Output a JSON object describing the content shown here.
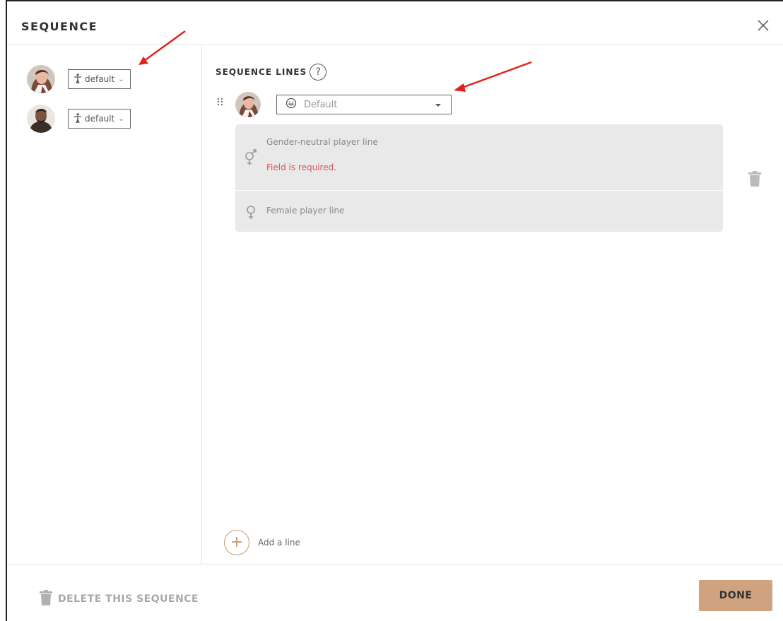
{
  "dialog": {
    "title": "SEQUENCE",
    "close_icon": "close-icon"
  },
  "characters": [
    {
      "avatar": "avatar-woman",
      "pose_icon": "person-pose-icon",
      "pose_label": "default"
    },
    {
      "avatar": "avatar-man",
      "pose_icon": "person-pose-icon",
      "pose_label": "default"
    }
  ],
  "sequence_lines": {
    "title": "SEQUENCE LINES",
    "help_icon": "?",
    "line": {
      "mood_placeholder": "Default",
      "gender_neutral_label": "Gender-neutral player line",
      "error": "Field is required.",
      "female_label": "Female player line"
    },
    "add_line_label": "Add a line",
    "add_icon": "+"
  },
  "footer": {
    "delete_label": "DELETE THIS SEQUENCE",
    "done_label": "DONE"
  },
  "colors": {
    "accent": "#cfa37f",
    "error": "#e04f4f",
    "annotation_arrow": "#e3201b",
    "card_bg": "#e9e9e9"
  }
}
